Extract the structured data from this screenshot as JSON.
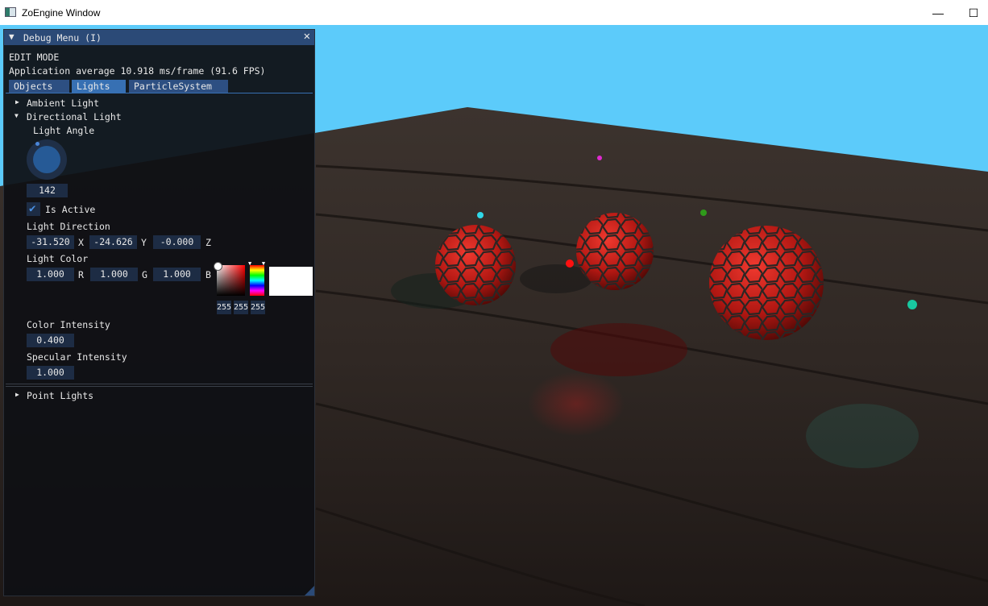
{
  "window": {
    "title": "ZoEngine Window",
    "minimize_glyph": "—",
    "maximize_glyph": "☐"
  },
  "colors": {
    "sky": "#5ccbfa",
    "panel_header": "#2b4a77",
    "tab_active": "#3770b3",
    "field_bg": "#1d2c44"
  },
  "debug_menu": {
    "title": "Debug Menu (I)",
    "collapse_glyph": "▼",
    "close_glyph": "✕",
    "mode": "EDIT MODE",
    "perf": "Application average 10.918 ms/frame (91.6 FPS)",
    "tabs": [
      "Objects",
      "Lights",
      "ParticleSystem"
    ],
    "active_tab": "Lights",
    "sections": {
      "ambient": {
        "arrow": "▶",
        "label": "Ambient Light"
      },
      "directional": {
        "arrow": "▼",
        "label": "Directional Light",
        "angle_label": "Light Angle",
        "angle_value": "142",
        "is_active_label": "Is Active",
        "is_active": true,
        "direction_label": "Light Direction",
        "direction": {
          "x": "-31.520",
          "y": "-24.626",
          "z": "-0.000",
          "x_label": "X",
          "y_label": "Y",
          "z_label": "Z"
        },
        "color_label": "Light Color",
        "color": {
          "r": "1.000",
          "g": "1.000",
          "b": "1.000",
          "r_label": "R",
          "g_label": "G",
          "b_label": "B"
        },
        "color_bytes": [
          "255",
          "255",
          "255"
        ],
        "intensity_label": "Color Intensity",
        "intensity": "0.400",
        "specular_label": "Specular Intensity",
        "specular": "1.000"
      },
      "point": {
        "arrow": "▶",
        "label": "Point Lights"
      }
    }
  }
}
